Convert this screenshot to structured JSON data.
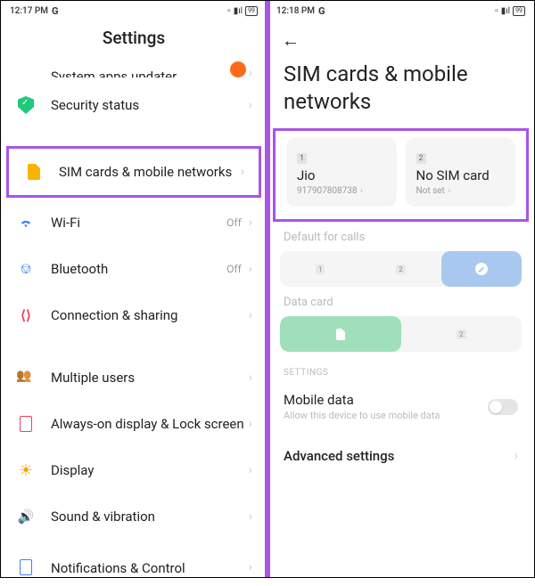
{
  "left": {
    "statusbar": {
      "time": "12:17 PM",
      "g": "G",
      "battery": "99"
    },
    "title": "Settings",
    "items": {
      "updater": {
        "label": "System apps updater"
      },
      "security": {
        "label": "Security status"
      },
      "sim": {
        "label": "SIM cards & mobile networks"
      },
      "wifi": {
        "label": "Wi-Fi",
        "status": "Off"
      },
      "bluetooth": {
        "label": "Bluetooth",
        "status": "Off"
      },
      "connshare": {
        "label": "Connection & sharing"
      },
      "multiuser": {
        "label": "Multiple users"
      },
      "aod": {
        "label": "Always-on display & Lock screen"
      },
      "display": {
        "label": "Display"
      },
      "sound": {
        "label": "Sound & vibration"
      },
      "notif": {
        "label": "Notifications & Control"
      }
    }
  },
  "right": {
    "statusbar": {
      "time": "12:18 PM",
      "g": "G",
      "battery": "99"
    },
    "title": "SIM cards & mobile networks",
    "sim1": {
      "num": "1",
      "name": "Jio",
      "sub": "917907808738"
    },
    "sim2": {
      "num": "2",
      "name": "No SIM card",
      "sub": "Not set"
    },
    "default_calls_label": "Default for calls",
    "opt1": "1",
    "opt2": "2",
    "data_card_label": "Data card",
    "settings_header": "SETTINGS",
    "mobile_data": {
      "title": "Mobile data",
      "sub": "Allow this device to use mobile data"
    },
    "advanced": "Advanced settings"
  }
}
